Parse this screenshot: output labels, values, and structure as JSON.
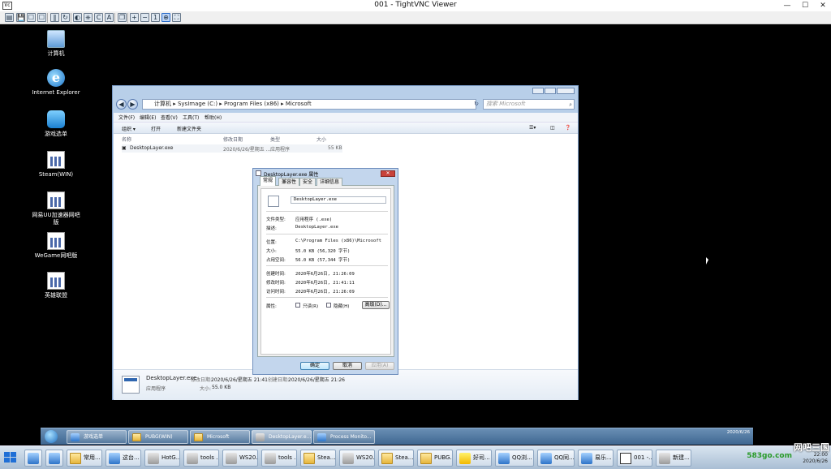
{
  "viewer": {
    "icon_label": "Vc",
    "title": "001 - TightVNC Viewer",
    "min_glyph": "—",
    "max_glyph": "☐",
    "close_glyph": "✕",
    "toolbar_glyphs": [
      "▤",
      "💾",
      "☐",
      "☐",
      "☐",
      "‖",
      "↻",
      "◐",
      "⎈",
      "C",
      "A",
      "❐",
      "+",
      "−",
      "1",
      "⊕",
      "⛶"
    ]
  },
  "desktop_icons": [
    {
      "label": "计算机",
      "icon": "computer-icon"
    },
    {
      "label": "Internet Explorer",
      "icon": "ie-icon"
    },
    {
      "label": "游戏选单",
      "icon": "game-menu-icon"
    },
    {
      "label": "Steam(WIN)",
      "icon": "document-icon"
    },
    {
      "label": "网易UU加速器网吧版",
      "icon": "document-icon"
    },
    {
      "label": "WeGame网吧版",
      "icon": "document-icon"
    },
    {
      "label": "英雄联盟",
      "icon": "document-icon"
    }
  ],
  "explorer": {
    "breadcrumb": "计算机 ▸ SysImage (C:) ▸ Program Files (x86) ▸ Microsoft",
    "search_placeholder": "搜索 Microsoft",
    "menu": [
      "文件(F)",
      "编辑(E)",
      "查看(V)",
      "工具(T)",
      "帮助(H)"
    ],
    "commands": [
      "组织 ▾",
      "打开",
      "新建文件夹"
    ],
    "columns": [
      "名称",
      "修改日期",
      "类型",
      "大小"
    ],
    "file": {
      "name": "DesktopLayer.exe",
      "modified": "2020/6/26/星期五 ...",
      "type": "应用程序",
      "size": "55 KB"
    },
    "details": {
      "name": "DesktopLayer.exe",
      "modified_label": "修改日期:",
      "modified": "2020/6/26/星期五 21:41",
      "created_label": "创建日期:",
      "created": "2020/6/26/星期五 21:26",
      "type": "应用程序",
      "size_label": "大小:",
      "size": "55.0 KB"
    }
  },
  "properties": {
    "title": "DesktopLayer.exe 属性",
    "tabs": [
      "常规",
      "兼容性",
      "安全",
      "详细信息"
    ],
    "filename": "DesktopLayer.exe",
    "rows": [
      {
        "label": "文件类型:",
        "value": "应用程序 (.exe)"
      },
      {
        "label": "描述:",
        "value": "DesktopLayer.exe"
      },
      {
        "label": "位置:",
        "value": "C:\\Program Files (x86)\\Microsoft"
      },
      {
        "label": "大小:",
        "value": "55.0 KB (56,320 字节)"
      },
      {
        "label": "占用空间:",
        "value": "56.0 KB (57,344 字节)"
      },
      {
        "label": "创建时间:",
        "value": "2020年6月26日, 21:26:09"
      },
      {
        "label": "修改时间:",
        "value": "2020年6月26日, 21:41:11"
      },
      {
        "label": "访问时间:",
        "value": "2020年6月26日, 21:26:09"
      }
    ],
    "attributes_label": "属性:",
    "readonly_label": "只读(R)",
    "hidden_label": "隐藏(H)",
    "advanced_label": "高级(D)...",
    "ok_label": "确定",
    "cancel_label": "取消",
    "apply_label": "应用(A)"
  },
  "remote_taskbar": {
    "items": [
      "游戏选单",
      "PUBG(WIN)",
      "Microsoft",
      "DesktopLayer.e...",
      "Process Monito..."
    ],
    "clock_time": "2020/6/26",
    "clock_date": "2020/6/26"
  },
  "local_taskbar": {
    "items": [
      "常用...",
      "这台...",
      "HotG...",
      "tools ...",
      "WS20...",
      "tools ...",
      "Stea...",
      "WS20...",
      "Stea...",
      "PUBG...",
      "好司...",
      "QQ浏...",
      "QQ同...",
      "易乐...",
      "001 -...",
      "新建..."
    ],
    "clock_time": "22:00",
    "clock_date": "2020/6/26",
    "watermark": "网吧三国",
    "watermark_site": "583go.com"
  }
}
